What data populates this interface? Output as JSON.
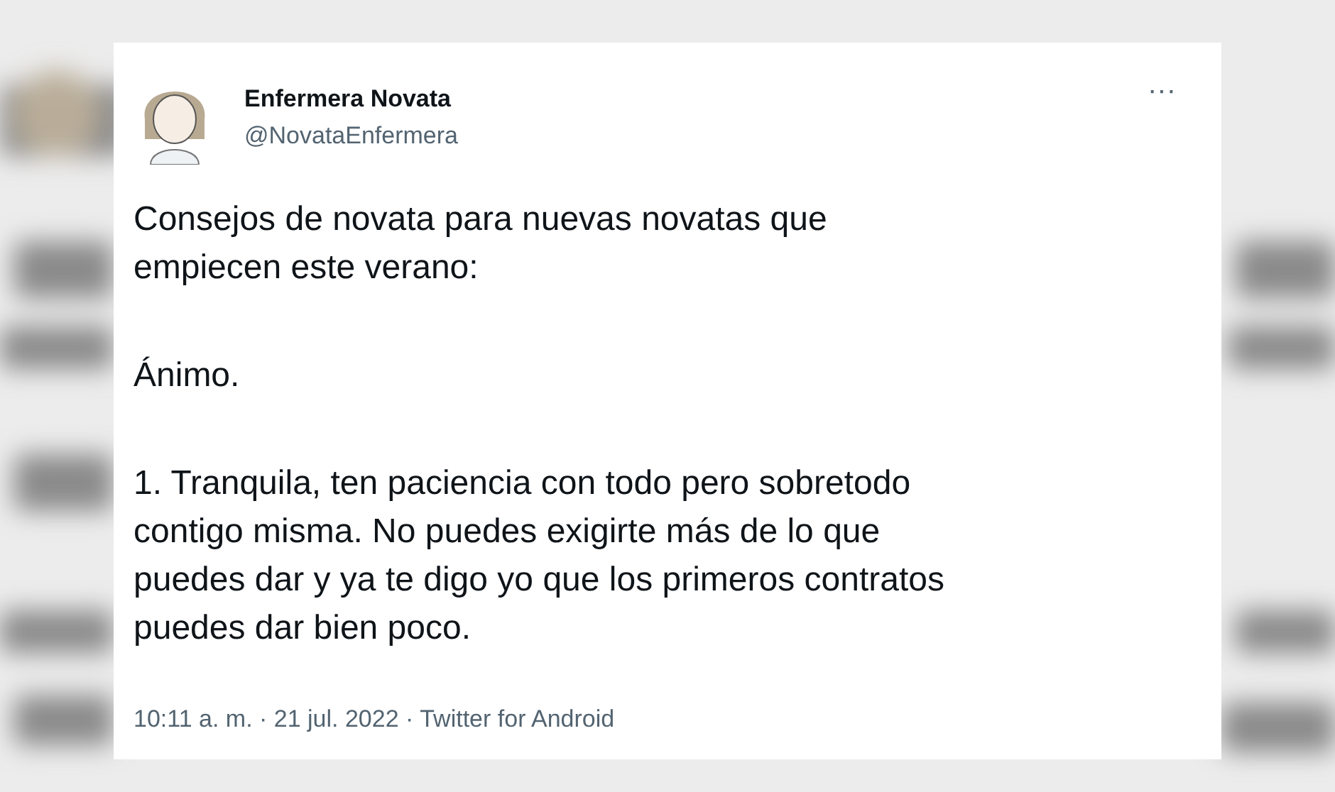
{
  "tweet": {
    "author": {
      "name": "Enfermera Novata",
      "handle": "@NovataEnfermera"
    },
    "menu": "···",
    "paragraphs": [
      {
        "lines": [
          "Consejos de novata para nuevas novatas que",
          "empiecen este verano:"
        ]
      },
      {
        "lines": [
          "Ánimo."
        ]
      },
      {
        "lines": [
          "1. Tranquila, ten paciencia con todo pero sobretodo",
          "contigo misma. No puedes exigirte más de lo que",
          "puedes dar y ya te digo yo que los primeros contratos",
          "puedes dar bien poco."
        ]
      }
    ],
    "meta": "10:11 a. m. · 21 jul. 2022 · Twitter for Android"
  }
}
